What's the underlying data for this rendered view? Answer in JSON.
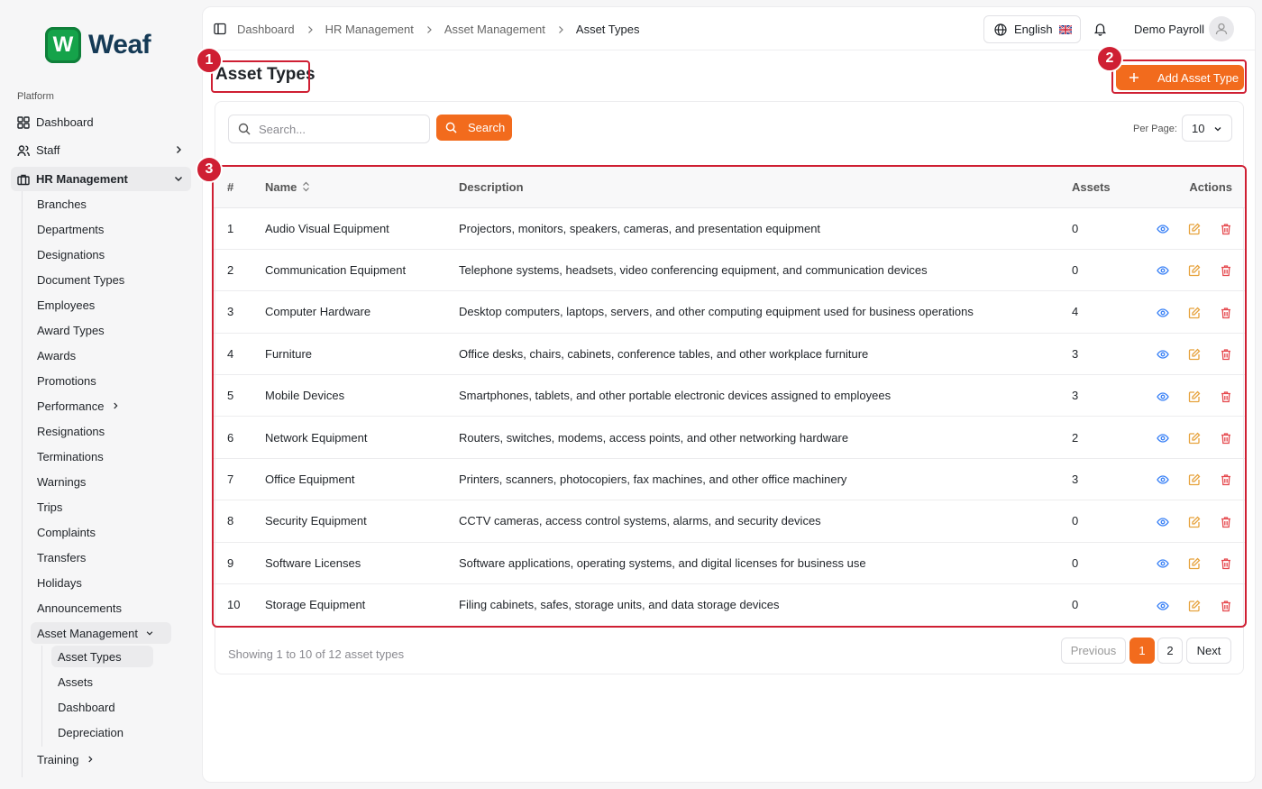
{
  "brand": {
    "logo_letter": "W",
    "name": "Weaf",
    "accent": "#f26b1d",
    "highlight": "#cf1f33"
  },
  "sidebar": {
    "section_label": "Platform",
    "items": [
      {
        "label": "Dashboard",
        "icon": "grid-icon"
      },
      {
        "label": "Staff",
        "icon": "users-icon"
      },
      {
        "label": "HR Management",
        "icon": "briefcase-icon"
      }
    ],
    "hr_sub": [
      "Branches",
      "Departments",
      "Designations",
      "Document Types",
      "Employees",
      "Award Types",
      "Awards",
      "Promotions",
      "Performance",
      "Resignations",
      "Terminations",
      "Warnings",
      "Trips",
      "Complaints",
      "Transfers",
      "Holidays",
      "Announcements",
      "Asset Management"
    ],
    "asset_sub": [
      "Asset Types",
      "Assets",
      "Dashboard",
      "Depreciation"
    ],
    "training": "Training"
  },
  "header": {
    "breadcrumb": [
      "Dashboard",
      "HR Management",
      "Asset Management",
      "Asset Types"
    ],
    "language": "English",
    "user": "Demo Payroll"
  },
  "page": {
    "title": "Asset Types",
    "add_button": "Add Asset Type",
    "badges": [
      "1",
      "2",
      "3"
    ]
  },
  "search": {
    "placeholder": "Search...",
    "button": "Search"
  },
  "per_page": {
    "label": "Per Page:",
    "value": "10"
  },
  "table": {
    "headers": [
      "#",
      "Name",
      "Description",
      "Assets",
      "Actions"
    ],
    "rows": [
      {
        "num": "1",
        "name": "Audio Visual Equipment",
        "desc": "Projectors, monitors, speakers, cameras, and presentation equipment",
        "assets": "0"
      },
      {
        "num": "2",
        "name": "Communication Equipment",
        "desc": "Telephone systems, headsets, video conferencing equipment, and communication devices",
        "assets": "0"
      },
      {
        "num": "3",
        "name": "Computer Hardware",
        "desc": "Desktop computers, laptops, servers, and other computing equipment used for business operations",
        "assets": "4"
      },
      {
        "num": "4",
        "name": "Furniture",
        "desc": "Office desks, chairs, cabinets, conference tables, and other workplace furniture",
        "assets": "3"
      },
      {
        "num": "5",
        "name": "Mobile Devices",
        "desc": "Smartphones, tablets, and other portable electronic devices assigned to employees",
        "assets": "3"
      },
      {
        "num": "6",
        "name": "Network Equipment",
        "desc": "Routers, switches, modems, access points, and other networking hardware",
        "assets": "2"
      },
      {
        "num": "7",
        "name": "Office Equipment",
        "desc": "Printers, scanners, photocopiers, fax machines, and other office machinery",
        "assets": "3"
      },
      {
        "num": "8",
        "name": "Security Equipment",
        "desc": "CCTV cameras, access control systems, alarms, and security devices",
        "assets": "0"
      },
      {
        "num": "9",
        "name": "Software Licenses",
        "desc": "Software applications, operating systems, and digital licenses for business use",
        "assets": "0"
      },
      {
        "num": "10",
        "name": "Storage Equipment",
        "desc": "Filing cabinets, safes, storage units, and data storage devices",
        "assets": "0"
      }
    ]
  },
  "pagination": {
    "showing": "Showing 1 to 10 of 12 asset types",
    "previous": "Previous",
    "pages": [
      "1",
      "2"
    ],
    "next": "Next"
  }
}
